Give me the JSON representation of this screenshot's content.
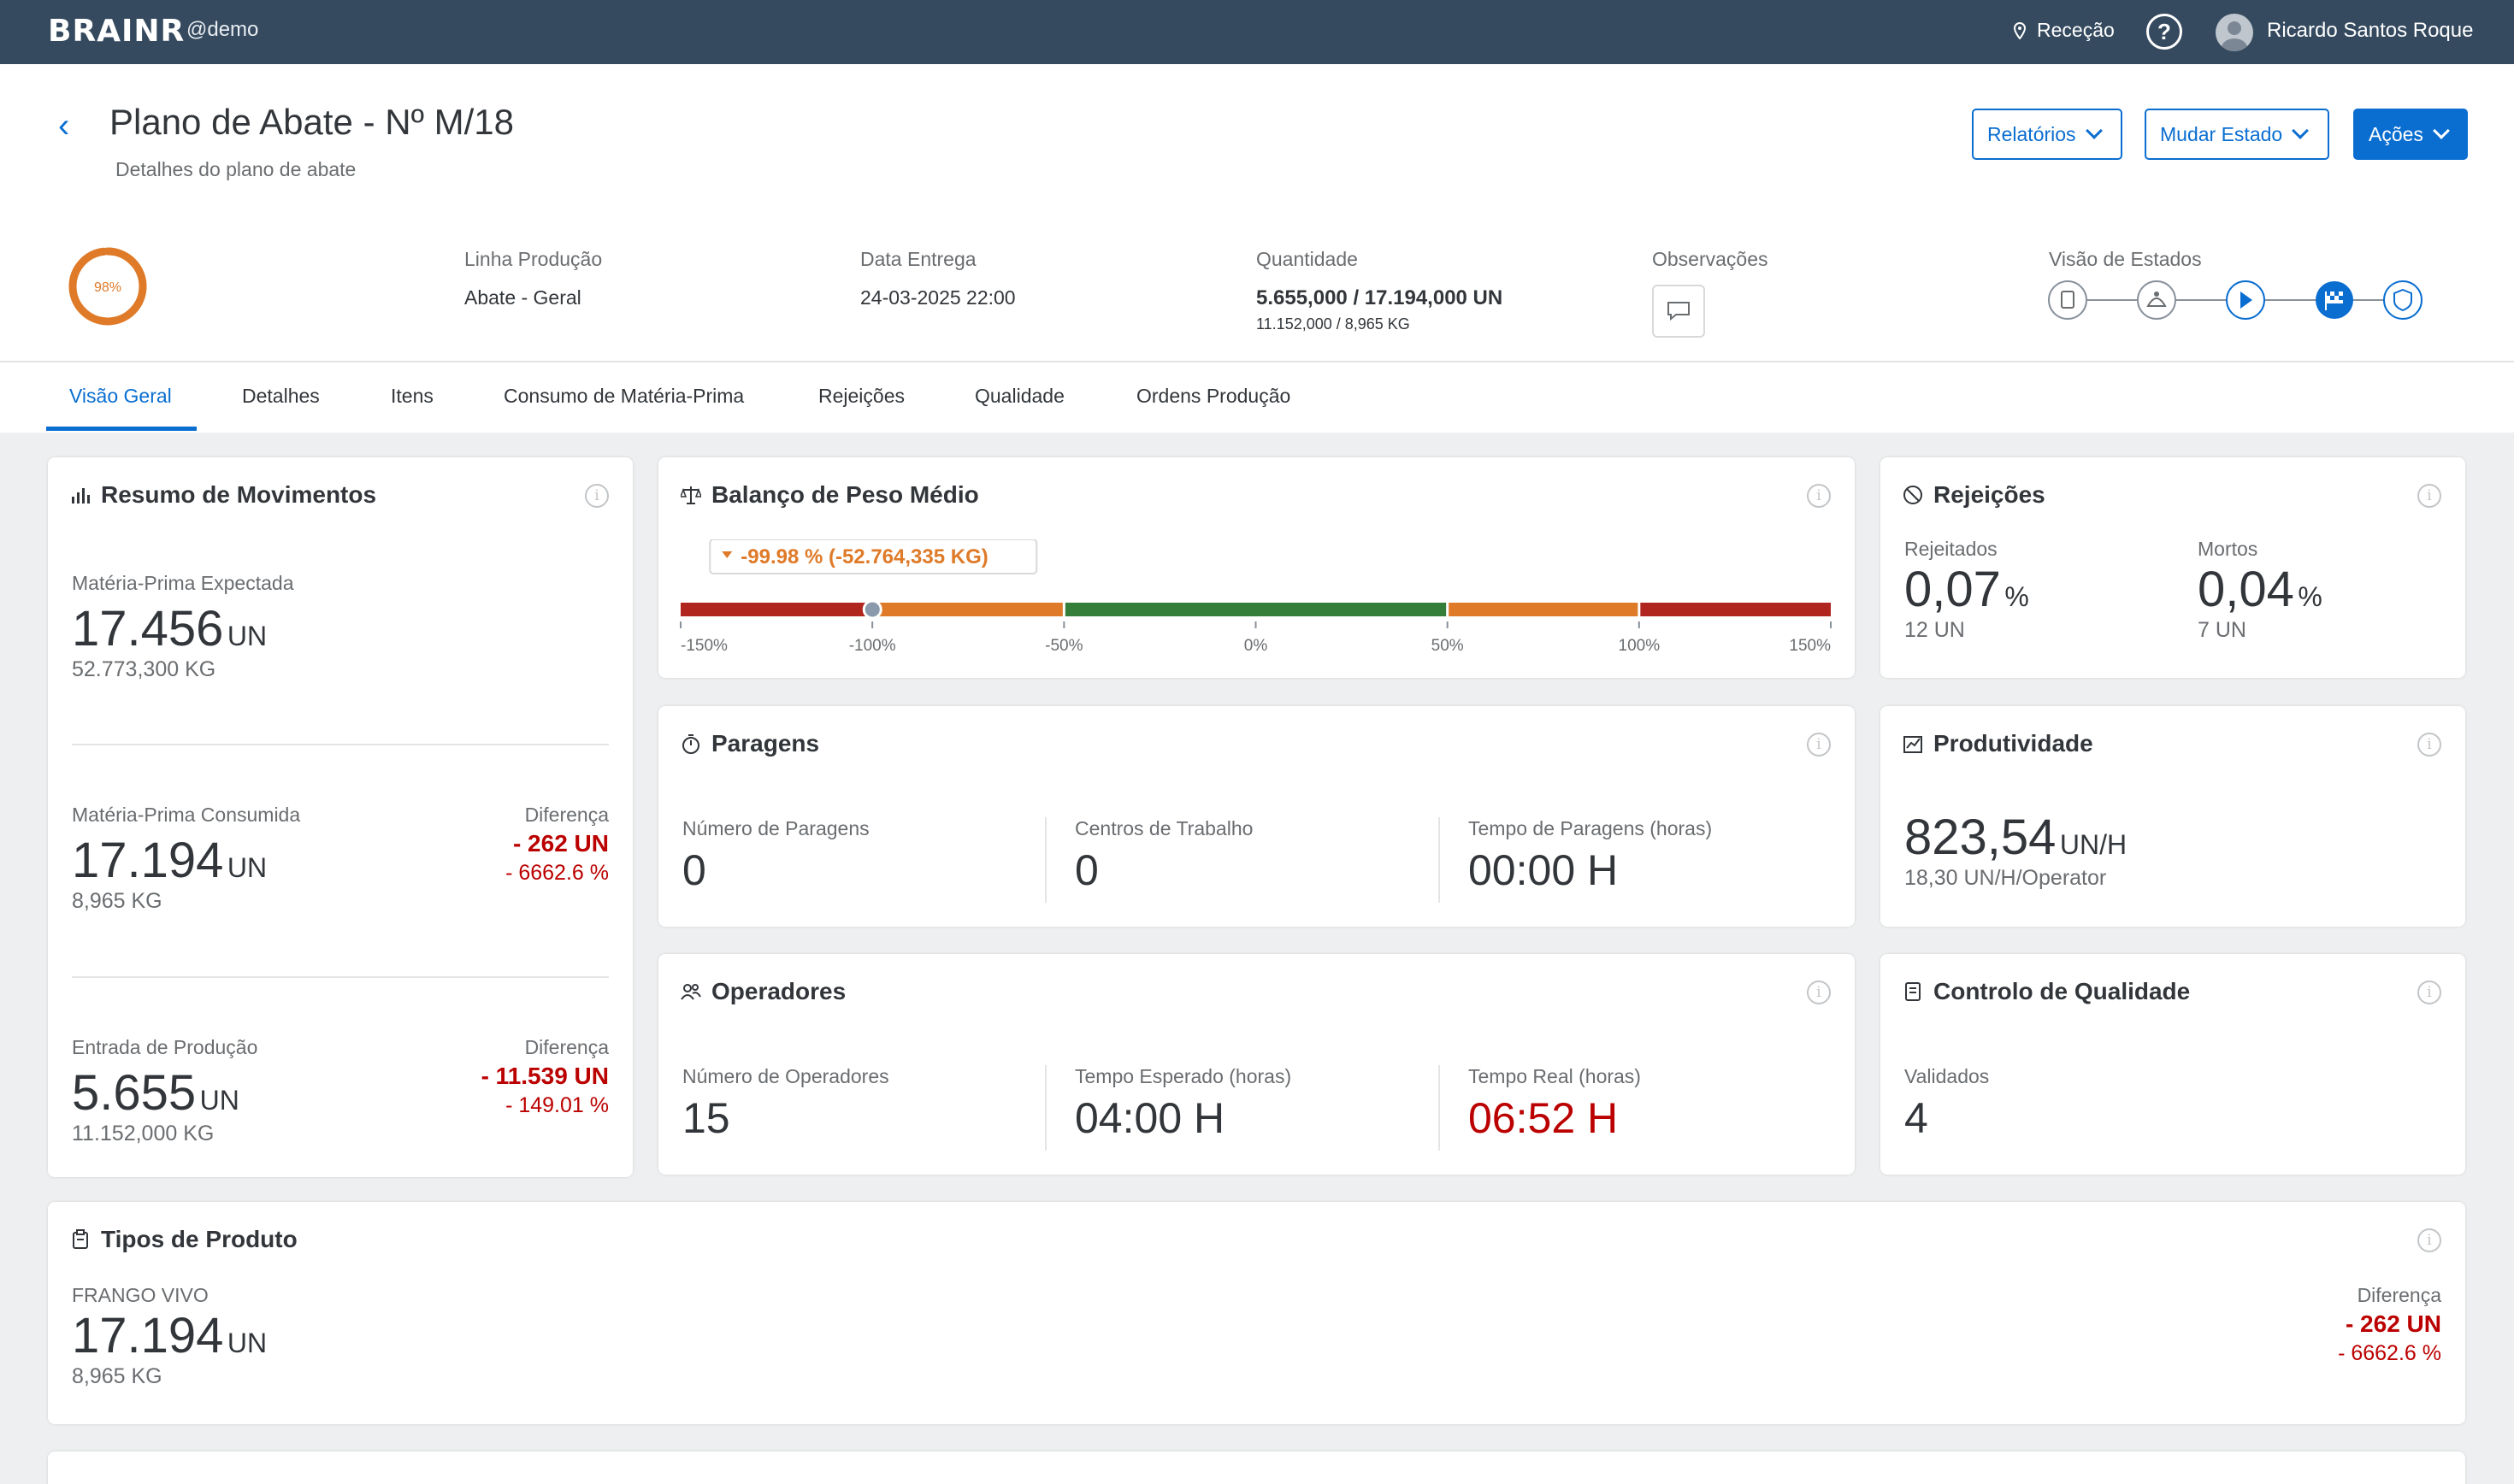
{
  "topbar": {
    "logo": "BRAINR",
    "tenant": "@demo",
    "location": "Receção",
    "help": "?",
    "user": "Ricardo Santos Roque"
  },
  "header": {
    "back": "‹",
    "title": "Plano de Abate - Nº M/18",
    "subtitle": "Detalhes do plano de abate",
    "buttons": {
      "reports": "Relatórios",
      "change_state": "Mudar Estado",
      "actions": "Ações"
    },
    "progress_label": "98%",
    "progress_value": 0.98,
    "line_label": "Linha Produção",
    "line_value": "Abate - Geral",
    "date_label": "Data Entrega",
    "date_value": "24-03-2025 22:00",
    "qty_label": "Quantidade",
    "qty_value": "5.655,000 / 17.194,000 UN",
    "qty_sub": "11.152,000 / 8,965 KG",
    "obs_label": "Observações",
    "states_label": "Visão de Estados",
    "states": [
      "document-icon",
      "chicken-icon",
      "play-icon",
      "flag-icon",
      "shield-icon"
    ],
    "active_state": 3
  },
  "tabs": [
    "Visão Geral",
    "Detalhes",
    "Itens",
    "Consumo de Matéria-Prima",
    "Rejeições",
    "Qualidade",
    "Ordens Produção"
  ],
  "resumo": {
    "title": "Resumo de Movimentos",
    "info": "i",
    "r1": {
      "label": "Matéria-Prima Expectada",
      "value": "17.456",
      "unit": "UN",
      "kg": "52.773,300 KG"
    },
    "r2": {
      "label": "Matéria-Prima Consumida",
      "value": "17.194",
      "unit": "UN",
      "kg": "8,965 KG",
      "diff_label": "Diferença",
      "diff_value": "- 262 UN",
      "diff_pct": "- 6662.6 %"
    },
    "r3": {
      "label": "Entrada de Produção",
      "value": "5.655",
      "unit": "UN",
      "kg": "11.152,000 KG",
      "diff_label": "Diferença",
      "diff_value": "- 11.539 UN",
      "diff_pct": "- 149.01 %"
    }
  },
  "balanco": {
    "title": "Balanço de Peso Médio",
    "info": "i",
    "marker_label": "-99.98 % (-52.764,335 KG)",
    "marker_value": -99.98,
    "ticks": [
      "-150%",
      "-100%",
      "-50%",
      "0%",
      "50%",
      "100%",
      "150%"
    ],
    "colors": {
      "red": "#b0261f",
      "orange": "#df7a28",
      "green": "#357e3a"
    }
  },
  "rejeicoes": {
    "title": "Rejeições",
    "info": "i",
    "rej_label": "Rejeitados",
    "rej_value": "0,07",
    "rej_unit": "%",
    "rej_un": "12 UN",
    "mortos_label": "Mortos",
    "mortos_value": "0,04",
    "mortos_unit": "%",
    "mortos_un": "7 UN"
  },
  "paragens": {
    "title": "Paragens",
    "info": "i",
    "c1_label": "Número de Paragens",
    "c1_value": "0",
    "c2_label": "Centros de Trabalho",
    "c2_value": "0",
    "c3_label": "Tempo de Paragens (horas)",
    "c3_value": "00:00 H"
  },
  "produtividade": {
    "title": "Produtividade",
    "info": "i",
    "value": "823,54",
    "unit": "UN/H",
    "sub": "18,30 UN/H/Operator"
  },
  "operadores": {
    "title": "Operadores",
    "info": "i",
    "c1_label": "Número de Operadores",
    "c1_value": "15",
    "c2_label": "Tempo Esperado (horas)",
    "c2_value": "04:00 H",
    "c3_label": "Tempo Real (horas)",
    "c3_value": "06:52 H"
  },
  "qualidade": {
    "title": "Controlo de Qualidade",
    "info": "i",
    "label": "Validados",
    "value": "4"
  },
  "tipos": {
    "title": "Tipos de Produto",
    "info": "i",
    "label": "FRANGO VIVO",
    "value": "17.194",
    "unit": "UN",
    "kg": "8,965 KG",
    "diff_label": "Diferença",
    "diff_value": "- 262 UN",
    "diff_pct": "- 6662.6 %"
  }
}
